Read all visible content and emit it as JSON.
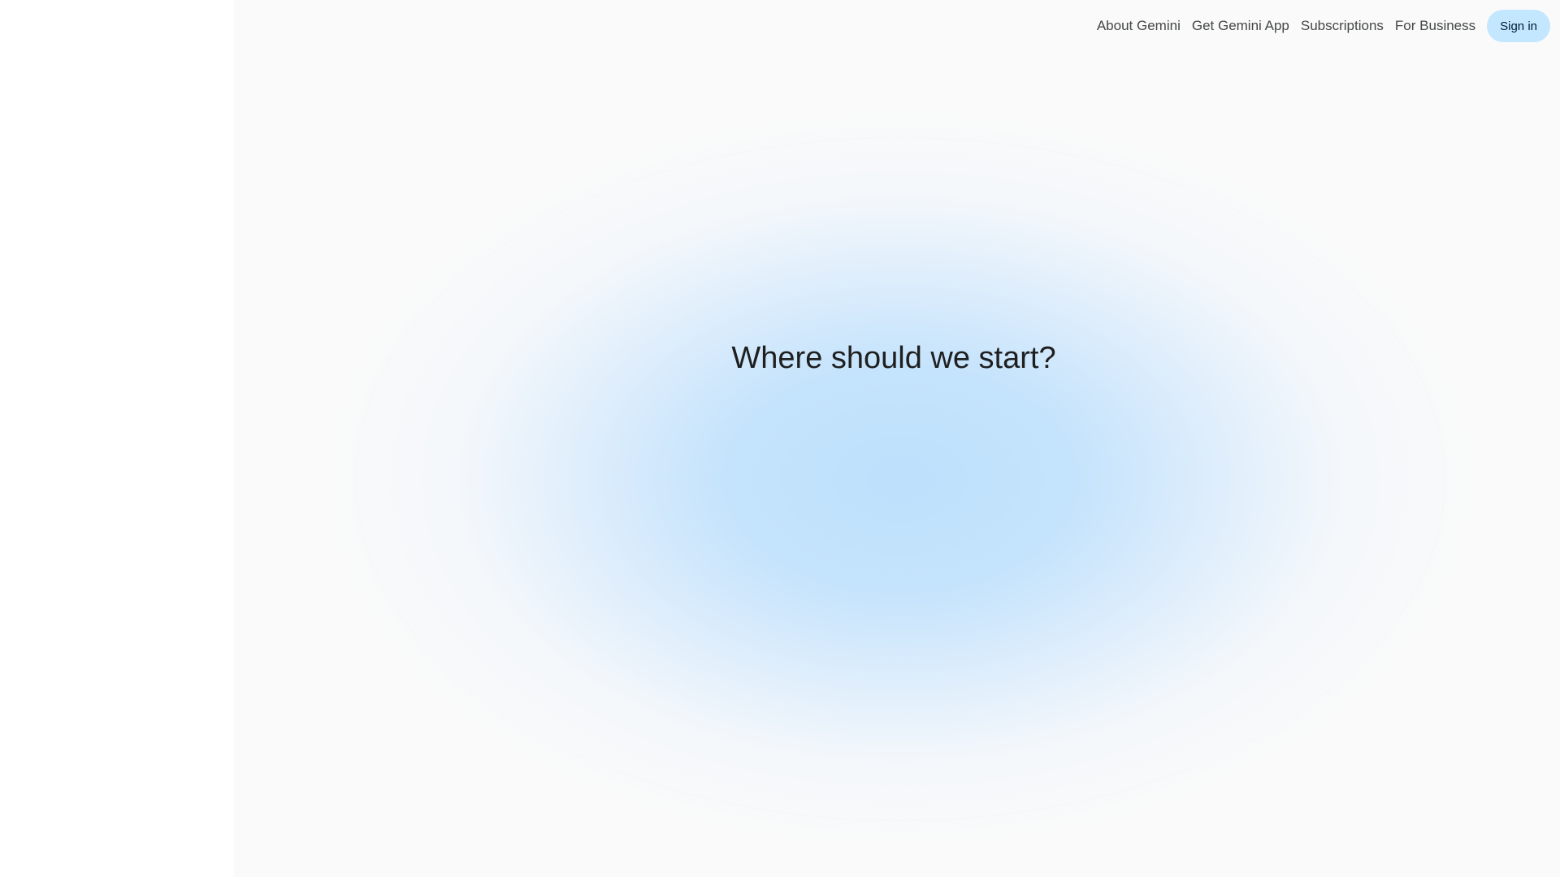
{
  "nav": {
    "links": [
      {
        "label": "About Gemini"
      },
      {
        "label": "Get Gemini App"
      },
      {
        "label": "Subscriptions"
      },
      {
        "label": "For Business"
      }
    ],
    "signin_label": "Sign in"
  },
  "main": {
    "headline": "Where should we start?"
  },
  "colors": {
    "signin_bg": "#c2e7ff",
    "glow": "#bee0fc",
    "background": "#fafafa"
  }
}
